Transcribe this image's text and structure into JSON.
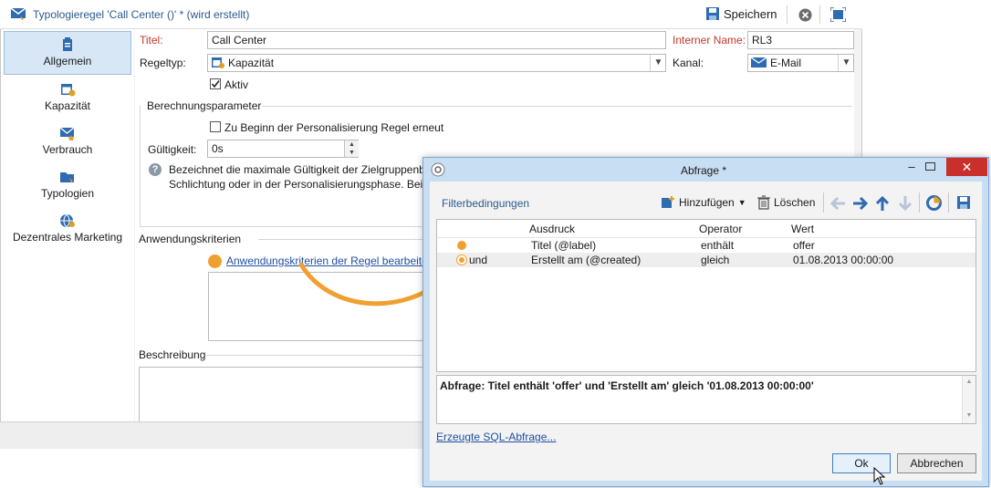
{
  "window": {
    "title": "Typologieregel 'Call Center ()' * (wird erstellt)",
    "save_label": "Speichern"
  },
  "sidebar": {
    "items": [
      {
        "label": "Allgemein",
        "icon": "clipboard-icon",
        "selected": true
      },
      {
        "label": "Kapazität",
        "icon": "calendar-icon",
        "selected": false
      },
      {
        "label": "Verbrauch",
        "icon": "mail-star-icon",
        "selected": false
      },
      {
        "label": "Typologien",
        "icon": "folder-icon",
        "selected": false
      },
      {
        "label": "Dezentrales Marketing",
        "icon": "globe-icon",
        "selected": false
      }
    ]
  },
  "form": {
    "title_label": "Titel:",
    "title_value": "Call Center",
    "internal_name_label": "Interner Name:",
    "internal_name_value": "RL3",
    "ruletype_label": "Regeltyp:",
    "ruletype_value": "Kapazität",
    "channel_label": "Kanal:",
    "channel_value": "E-Mail",
    "active_label": "Aktiv",
    "active_checked": true,
    "calc_group_label": "Berechnungsparameter",
    "reapply_label": "Zu Beginn der Personalisierung Regel erneut",
    "reapply_checked": false,
    "validity_label": "Gültigkeit:",
    "validity_value": "0s",
    "info_line1": "Bezeichnet die maximale Gültigkeit der Zielgruppenb",
    "info_line2": "Schlichtung oder in der Personalisierungsphase. Bei A",
    "criteria_group_label": "Anwendungskriterien",
    "criteria_link": "Anwendungskriterien der Regel bearbeite",
    "description_label": "Beschreibung"
  },
  "dialog": {
    "title": "Abfrage *",
    "tab_label": "Filterbedingungen",
    "add_label": "Hinzufügen",
    "delete_label": "Löschen",
    "columns": [
      "Ausdruck",
      "Operator",
      "Wert"
    ],
    "rows": [
      {
        "prefix": "",
        "expression": "Titel (@label)",
        "operator": "enthält",
        "value": "offer"
      },
      {
        "prefix": "und",
        "expression": "Erstellt am (@created)",
        "operator": "gleich",
        "value": "01.08.2013 00:00:00"
      }
    ],
    "query_text": "Abfrage: Titel enthält 'offer' und 'Erstellt am' gleich '01.08.2013 00:00:00'",
    "sql_link": "Erzeugte SQL-Abfrage...",
    "ok_label": "Ok",
    "cancel_label": "Abbrechen"
  },
  "colors": {
    "accent": "#2b5b8c",
    "orange": "#f0a030",
    "close_red": "#c9302c",
    "link": "#1f4fa0"
  }
}
